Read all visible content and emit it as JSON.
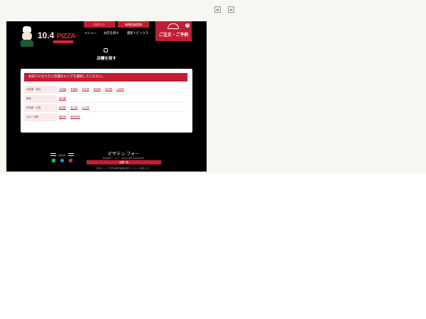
{
  "header": {
    "login_label": "ログイン",
    "register_label": "新規会員登録",
    "nav_menu": "メニュー",
    "nav_find_store": "お店を探す",
    "nav_topics": "最新トピックス",
    "order_label": "ご注文・ご予約",
    "brand_number": "10.4",
    "brand_name": "PIZZA"
  },
  "page": {
    "title": "店舗を探す",
    "panel_heading": "お知りになりたい店舗のエリアを選択してください。"
  },
  "areas": [
    {
      "label": "北海道・東北",
      "prefectures": [
        "北海道",
        "青森県",
        "岩手県",
        "宮城県",
        "秋田県",
        "山形県"
      ]
    },
    {
      "label": "関東",
      "prefectures": [
        "東京都"
      ]
    },
    {
      "label": "甲信越・北陸",
      "prefectures": [
        "新潟県",
        "富山県",
        "石川県"
      ]
    },
    {
      "label": "九州・沖縄",
      "prefectures": [
        "福岡県",
        "鹿児島県"
      ]
    }
  ],
  "footer": {
    "follow_label": "公式SNS",
    "site_name": "ピザテン.フォー",
    "company_line": "株式会社テンフォー・日本法人番号0000000000",
    "store_list_button": "店舗一覧",
    "copyright": "企業のイメージ写真等の著作権は株式会社テンフォーに帰属します。"
  },
  "colors": {
    "accent": "#c21d33",
    "site_background": "#000000",
    "page_background": "#f8f6f1"
  }
}
